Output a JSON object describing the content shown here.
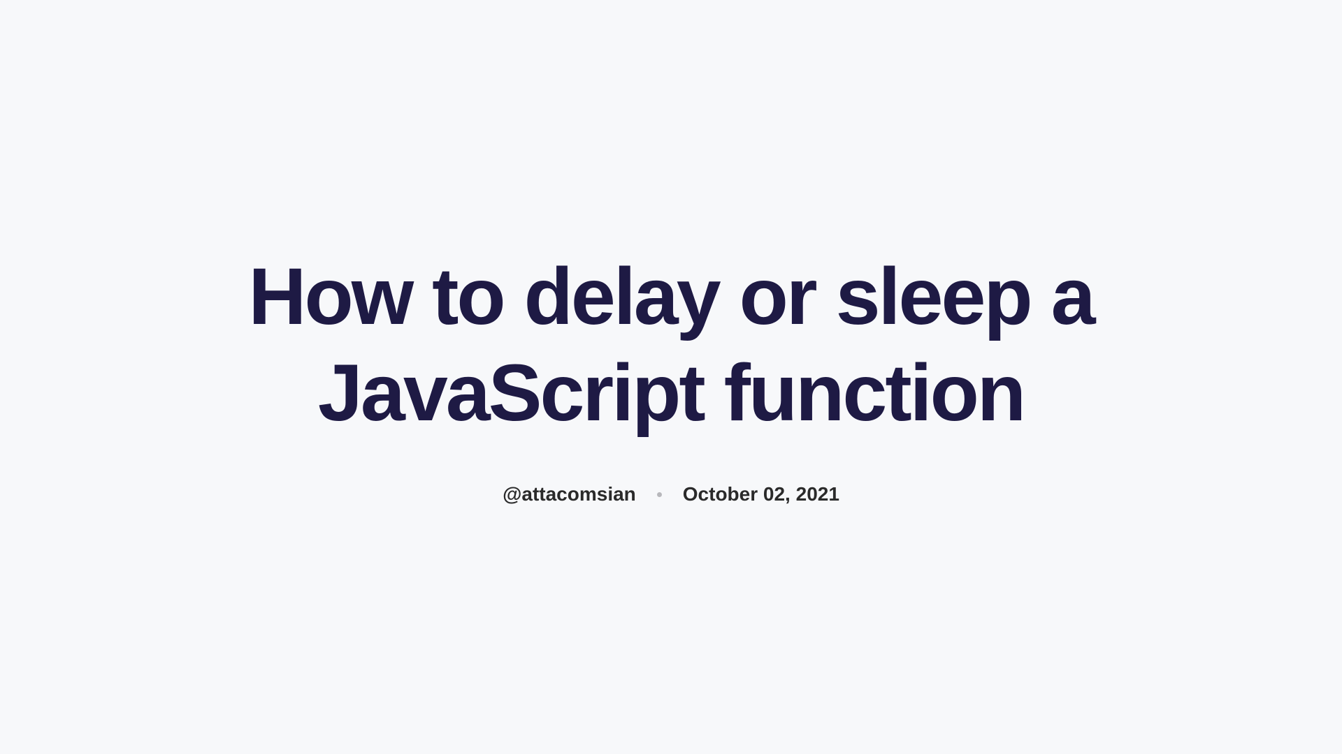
{
  "article": {
    "title": "How to delay or sleep a JavaScript function",
    "author": "@attacomsian",
    "date": "October 02, 2021"
  }
}
